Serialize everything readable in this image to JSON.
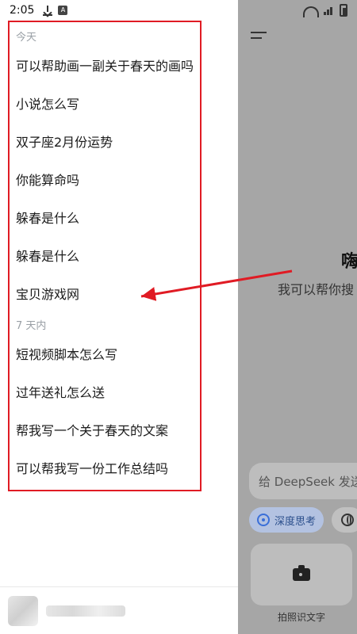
{
  "status_bar": {
    "time": "2:05",
    "colors": {
      "icons": "#333333"
    }
  },
  "drawer": {
    "sections": [
      {
        "label": "今天",
        "items": [
          "可以帮助画一副关于春天的画吗",
          "小说怎么写",
          "双子座2月份运势",
          "你能算命吗",
          "躲春是什么",
          "躲春是什么",
          "宝贝游戏网"
        ]
      },
      {
        "label": "7 天内",
        "items": [
          "短视频脚本怎么写",
          "过年送礼怎么送",
          "帮我写一个关于春天的文案",
          "可以帮我写一份工作总结吗"
        ]
      }
    ],
    "colors": {
      "highlight_border": "#e01b24"
    }
  },
  "content": {
    "greeting_title": "嗨",
    "greeting_subtitle": "我可以帮你搜",
    "input_placeholder": "给 DeepSeek 发送",
    "chips": {
      "deep_think": "深度思考"
    },
    "camera_label": "拍照识文字"
  }
}
